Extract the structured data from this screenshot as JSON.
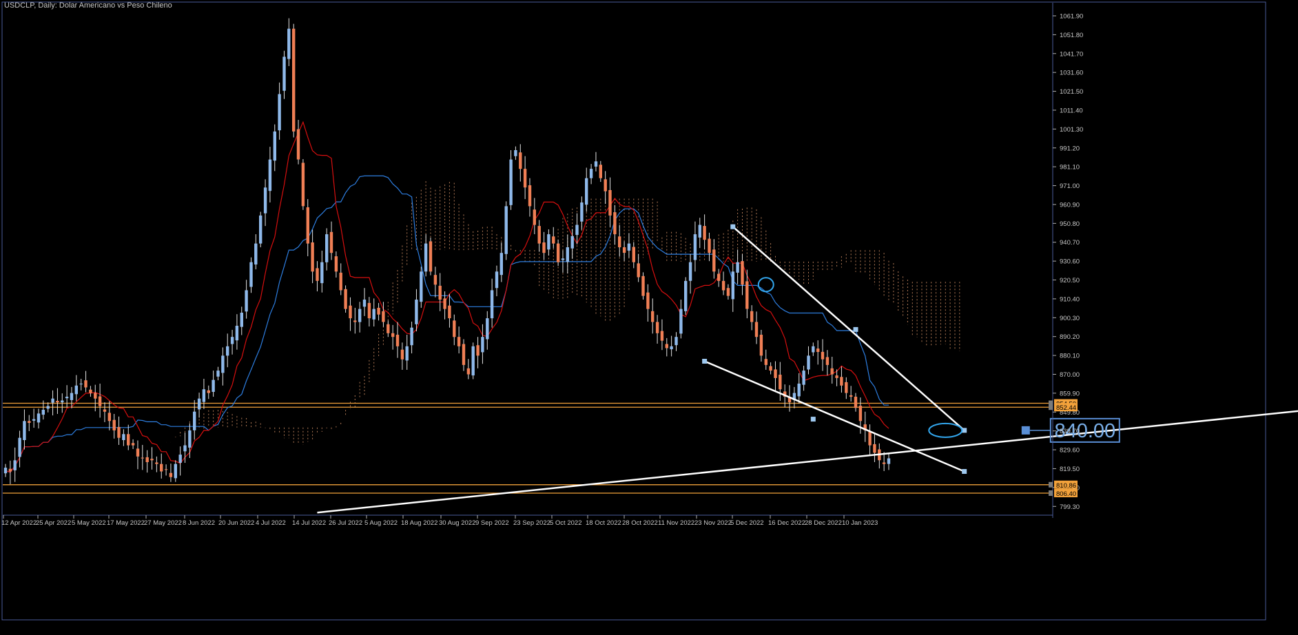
{
  "window_title": "USDCLP, Daily:  Dolar Americano vs Peso Chileno",
  "big_label": "840.00",
  "colors": {
    "background": "#000000",
    "frame": "#4a5d9a",
    "bull": "#8fb9ea",
    "bear": "#f07f55",
    "tenkan": "#d80f0f",
    "kijun": "#2e7fe2",
    "cloud": "#f0a574",
    "hline": "#f3a23b",
    "trend": "#ffffff",
    "annotation": "#33a8f0"
  },
  "chart_data": {
    "type": "candlestick",
    "symbol": "USDCLP",
    "timeframe": "Daily",
    "ylim": [
      794.6,
      1068.9
    ],
    "y_ticks": [
      "1061.90",
      "1051.80",
      "1041.70",
      "1031.60",
      "1021.50",
      "1011.40",
      "1001.30",
      "991.20",
      "981.10",
      "971.00",
      "960.90",
      "950.80",
      "940.70",
      "930.60",
      "920.50",
      "910.40",
      "900.30",
      "890.20",
      "880.10",
      "870.00",
      "859.90",
      "849.80",
      "839.70",
      "829.60",
      "819.50",
      "809.40",
      "799.30"
    ],
    "x_ticks": [
      "12 Apr 2022",
      "25 Apr 2022",
      "5 May 2022",
      "17 May 2022",
      "27 May 2022",
      "8 Jun 2022",
      "20 Jun 2022",
      "4 Jul 2022",
      "14 Jul 2022",
      "26 Jul 2022",
      "5 Aug 2022",
      "18 Aug 2022",
      "30 Aug 2022",
      "9 Sep 2022",
      "23 Sep 2022",
      "5 Oct 2022",
      "18 Oct 2022",
      "28 Oct 2022",
      "11 Nov 2022",
      "23 Nov 2022",
      "5 Dec 2022",
      "16 Dec 2022",
      "28 Dec 2022",
      "10 Jan 2023"
    ],
    "price_levels": [
      {
        "label": "854.50",
        "value": 854.5
      },
      {
        "label": "852.44",
        "value": 852.4
      },
      {
        "label": "810.86",
        "value": 810.9
      },
      {
        "label": "806.40",
        "value": 806.4
      }
    ],
    "closes": [
      820,
      818,
      824,
      836,
      845,
      844,
      846,
      849,
      851,
      853,
      857,
      855,
      856,
      858,
      860,
      864,
      865,
      863,
      860,
      857,
      853,
      850,
      845,
      840,
      836,
      838,
      832,
      832,
      826,
      825,
      823,
      824,
      822,
      818,
      819,
      815,
      822,
      827,
      832,
      840,
      850,
      857,
      862,
      860,
      867,
      872,
      880,
      885,
      890,
      896,
      903,
      915,
      930,
      940,
      955,
      970,
      985,
      1000,
      1020,
      1040,
      1055,
      1000,
      985,
      960,
      940,
      925,
      920,
      930,
      945,
      935,
      925,
      915,
      905,
      900,
      898,
      905,
      910,
      900,
      905,
      902,
      898,
      892,
      890,
      885,
      878,
      885,
      895,
      910,
      925,
      940,
      925,
      918,
      910,
      905,
      900,
      890,
      885,
      875,
      870,
      885,
      880,
      890,
      900,
      915,
      925,
      935,
      960,
      985,
      990,
      980,
      970,
      960,
      950,
      940,
      935,
      945,
      940,
      930,
      932,
      938,
      944,
      950,
      962,
      975,
      980,
      984,
      975,
      968,
      955,
      945,
      938,
      935,
      940,
      930,
      922,
      912,
      905,
      898,
      892,
      888,
      884,
      885,
      890,
      905,
      920,
      930,
      945,
      950,
      942,
      935,
      925,
      920,
      915,
      912,
      925,
      930,
      918,
      905,
      898,
      890,
      880,
      875,
      872,
      868,
      862,
      858,
      855,
      860,
      865,
      872,
      880,
      885,
      882,
      878,
      875,
      870,
      868,
      864,
      860,
      858,
      852,
      845,
      840,
      832,
      828,
      824,
      822,
      825
    ]
  }
}
